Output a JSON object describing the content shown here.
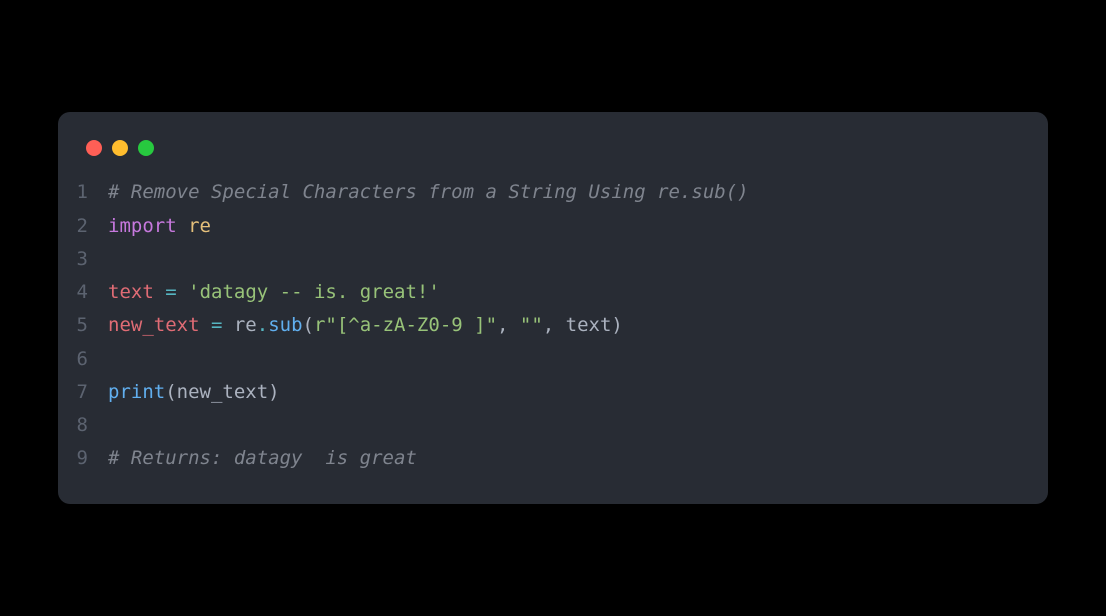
{
  "lines": [
    {
      "num": "1",
      "tokens": [
        {
          "cls": "comment",
          "text": "# Remove Special Characters from a String Using re.sub()"
        }
      ]
    },
    {
      "num": "2",
      "tokens": [
        {
          "cls": "keyword",
          "text": "import"
        },
        {
          "cls": "plain",
          "text": " "
        },
        {
          "cls": "module",
          "text": "re"
        }
      ]
    },
    {
      "num": "3",
      "tokens": []
    },
    {
      "num": "4",
      "tokens": [
        {
          "cls": "variable",
          "text": "text"
        },
        {
          "cls": "plain",
          "text": " "
        },
        {
          "cls": "operator",
          "text": "="
        },
        {
          "cls": "plain",
          "text": " "
        },
        {
          "cls": "string",
          "text": "'datagy -- is. great!'"
        }
      ]
    },
    {
      "num": "5",
      "tokens": [
        {
          "cls": "variable",
          "text": "new_text"
        },
        {
          "cls": "plain",
          "text": " "
        },
        {
          "cls": "operator",
          "text": "="
        },
        {
          "cls": "plain",
          "text": " re"
        },
        {
          "cls": "operator",
          "text": "."
        },
        {
          "cls": "function",
          "text": "sub"
        },
        {
          "cls": "plain",
          "text": "("
        },
        {
          "cls": "string",
          "text": "r\"[^a-zA-Z0-9 ]\""
        },
        {
          "cls": "plain",
          "text": ", "
        },
        {
          "cls": "string",
          "text": "\"\""
        },
        {
          "cls": "plain",
          "text": ", text)"
        }
      ]
    },
    {
      "num": "6",
      "tokens": []
    },
    {
      "num": "7",
      "tokens": [
        {
          "cls": "function",
          "text": "print"
        },
        {
          "cls": "plain",
          "text": "(new_text)"
        }
      ]
    },
    {
      "num": "8",
      "tokens": []
    },
    {
      "num": "9",
      "tokens": [
        {
          "cls": "comment",
          "text": "# Returns: datagy  is great"
        }
      ]
    }
  ]
}
